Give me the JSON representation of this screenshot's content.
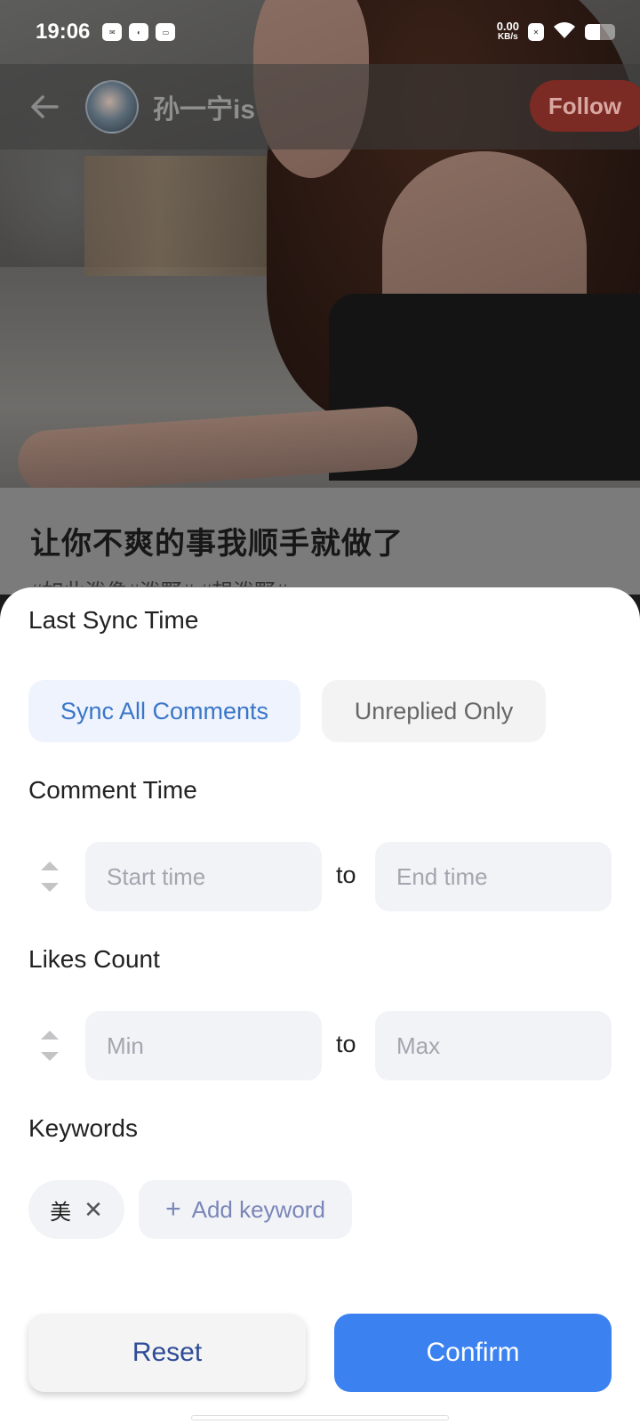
{
  "status_bar": {
    "time": "19:06",
    "net_speed_value": "0.00",
    "net_speed_unit": "KB/s",
    "battery_level": 0.5
  },
  "header": {
    "username": "孙一宁is",
    "follow_label": "Follow"
  },
  "post": {
    "title": "让你不爽的事我顺手就做了",
    "tags": "#如此泼像#泼野# #想泼野#"
  },
  "filter": {
    "last_sync": {
      "title": "Last Sync Time",
      "options": [
        "Sync All Comments",
        "Unreplied Only"
      ],
      "selected": "Sync All Comments"
    },
    "comment_time": {
      "title": "Comment Time",
      "start_placeholder": "Start time",
      "to_label": "to",
      "end_placeholder": "End time"
    },
    "likes_count": {
      "title": "Likes Count",
      "min_placeholder": "Min",
      "to_label": "to",
      "max_placeholder": "Max"
    },
    "keywords": {
      "title": "Keywords",
      "items": [
        "美"
      ],
      "add_label": "Add keyword"
    },
    "reset_label": "Reset",
    "confirm_label": "Confirm"
  },
  "colors": {
    "accent": "#3b82f0",
    "active_chip_bg": "#eef3fd",
    "active_chip_text": "#3a76c8",
    "follow_bg": "#7c2a24"
  },
  "icons": [
    "back-arrow-icon",
    "stepper-icon",
    "close-icon",
    "plus-icon",
    "wifi-icon",
    "battery-icon"
  ]
}
